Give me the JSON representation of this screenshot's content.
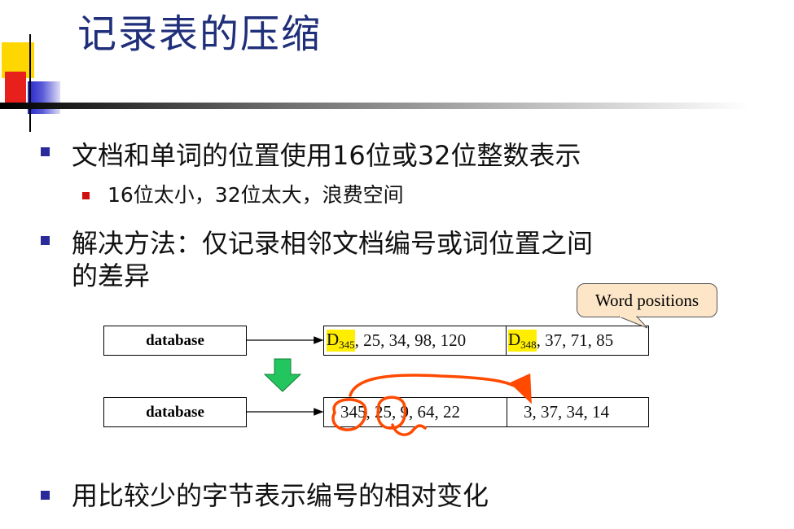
{
  "title": "记录表的压缩",
  "bullets": {
    "b1": "文档和单词的位置使用16位或32位整数表示",
    "b1_sub": "16位太小，32位太大，浪费空间",
    "b2_line1": "解决方法：仅记录相邻文档编号或词位置之间",
    "b2_line2": "的差异",
    "b3": "用比较少的字节表示编号的相对变化"
  },
  "callout": "Word positions",
  "diagram": {
    "term": "database",
    "row1": {
      "doc1_letter": "D",
      "doc1_sub": "345",
      "doc1_rest": ", 25, 34, 98, 120",
      "doc2_letter": "D",
      "doc2_sub": "348",
      "doc2_rest": ", 37, 71, 85"
    },
    "row2": {
      "part1": "345, 25, 9, 64, 22",
      "part2": "3, 37, 34, 14"
    }
  },
  "colors": {
    "title": "#1f2f7a",
    "highlight": "#ffee00",
    "annotation": "#ff4a00",
    "down_arrow": "#22c55e",
    "callout_bg": "#fde6c8"
  }
}
